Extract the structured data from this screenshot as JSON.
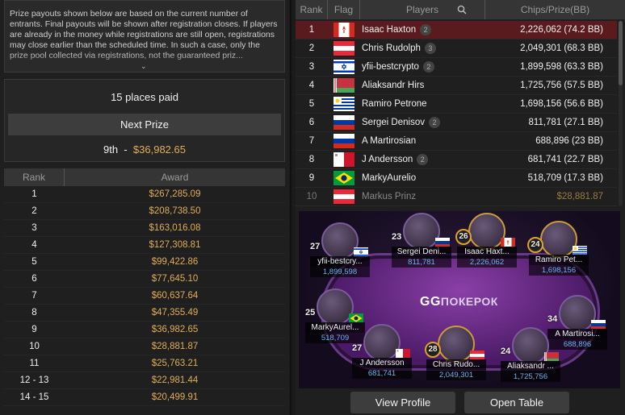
{
  "info": {
    "text": "Prize payouts shown below are based on the current number of entrants. Final payouts will be shown after registration closes. If players are already in the money while registrations are still open, registrations may close earlier than the scheduled time. In such a case, only the prize pool collected via registrations, not the guaranteed priz..."
  },
  "places": {
    "title": "15 places paid",
    "next_label": "Next Prize",
    "next_place": "9th",
    "next_sep": "-",
    "next_amount": "$36,982.65"
  },
  "awards": {
    "header_rank": "Rank",
    "header_award": "Award",
    "rows": [
      {
        "rank": "1",
        "award": "$267,285.09"
      },
      {
        "rank": "2",
        "award": "$208,738.50"
      },
      {
        "rank": "3",
        "award": "$163,016.08"
      },
      {
        "rank": "4",
        "award": "$127,308.81"
      },
      {
        "rank": "5",
        "award": "$99,422.86"
      },
      {
        "rank": "6",
        "award": "$77,645.10"
      },
      {
        "rank": "7",
        "award": "$60,637.64"
      },
      {
        "rank": "8",
        "award": "$47,355.49"
      },
      {
        "rank": "9",
        "award": "$36,982.65"
      },
      {
        "rank": "10",
        "award": "$28,881.87"
      },
      {
        "rank": "11",
        "award": "$25,763.21"
      },
      {
        "rank": "12 - 13",
        "award": "$22,981.44"
      },
      {
        "rank": "14 - 15",
        "award": "$20,499.91"
      }
    ]
  },
  "players": {
    "header_rank": "Rank",
    "header_flag": "Flag",
    "header_players": "Players",
    "header_chips": "Chips/Prize(BB)",
    "rows": [
      {
        "rank": "1",
        "flag": "canada",
        "name": "Isaac Haxton",
        "tag": "2",
        "chips": "2,226,062 (74.2 BB)"
      },
      {
        "rank": "2",
        "flag": "austria",
        "name": "Chris Rudolph",
        "tag": "3",
        "chips": "2,049,301 (68.3 BB)"
      },
      {
        "rank": "3",
        "flag": "israel",
        "name": "yfii-bestcrypto",
        "tag": "2",
        "chips": "1,899,598 (63.3 BB)"
      },
      {
        "rank": "4",
        "flag": "belarus",
        "name": "Aliaksandr Hirs",
        "tag": "",
        "chips": "1,725,756 (57.5 BB)"
      },
      {
        "rank": "5",
        "flag": "uruguay",
        "name": "Ramiro Petrone",
        "tag": "",
        "chips": "1,698,156 (56.6 BB)"
      },
      {
        "rank": "6",
        "flag": "russia",
        "name": "Sergei Denisov",
        "tag": "2",
        "chips": "811,781 (27.1 BB)"
      },
      {
        "rank": "7",
        "flag": "russia",
        "name": "A Martirosian",
        "tag": "",
        "chips": "688,896 (23 BB)"
      },
      {
        "rank": "8",
        "flag": "malta",
        "name": "J Andersson",
        "tag": "2",
        "chips": "681,741 (22.7 BB)"
      },
      {
        "rank": "9",
        "flag": "brazil",
        "name": "MarkyAurelio",
        "tag": "",
        "chips": "518,709 (17.3 BB)"
      },
      {
        "rank": "10",
        "flag": "austria",
        "name": "Markus Prinz",
        "tag": "",
        "chips": "$28,881.87"
      }
    ]
  },
  "table": {
    "logo_gg": "GG",
    "logo_text": "ПОКЕРОК",
    "seats": [
      {
        "num": "27",
        "name": "yfii-bestcry...",
        "chips": "1,899,598",
        "flag": "israel",
        "ring": false
      },
      {
        "num": "23",
        "name": "Sergei Deni...",
        "chips": "811,781",
        "flag": "russia",
        "ring": false
      },
      {
        "num": "26",
        "name": "Isaac Haxt...",
        "chips": "2,226,062",
        "flag": "canada",
        "ring": true
      },
      {
        "num": "24",
        "name": "Ramiro Pet...",
        "chips": "1,698,156",
        "flag": "uruguay",
        "ring": true
      },
      {
        "num": "25",
        "name": "MarkyAurel...",
        "chips": "518,709",
        "flag": "brazil",
        "ring": false
      },
      {
        "num": "34",
        "name": "A Martirosi...",
        "chips": "688,896",
        "flag": "russia",
        "ring": false
      },
      {
        "num": "27",
        "name": "J Andersson",
        "chips": "681,741",
        "flag": "malta",
        "ring": false
      },
      {
        "num": "28",
        "name": "Chris Rudo...",
        "chips": "2,049,301",
        "flag": "austria",
        "ring": true
      },
      {
        "num": "24",
        "name": "Aliaksandr ...",
        "chips": "1,725,756",
        "flag": "belarus",
        "ring": false
      }
    ]
  },
  "buttons": {
    "view_profile": "View Profile",
    "open_table": "Open Table"
  },
  "colors": {
    "gold": "#e0ad5a",
    "selected_row": "#5a1b1e",
    "chips_blue": "#6fb3e8"
  }
}
